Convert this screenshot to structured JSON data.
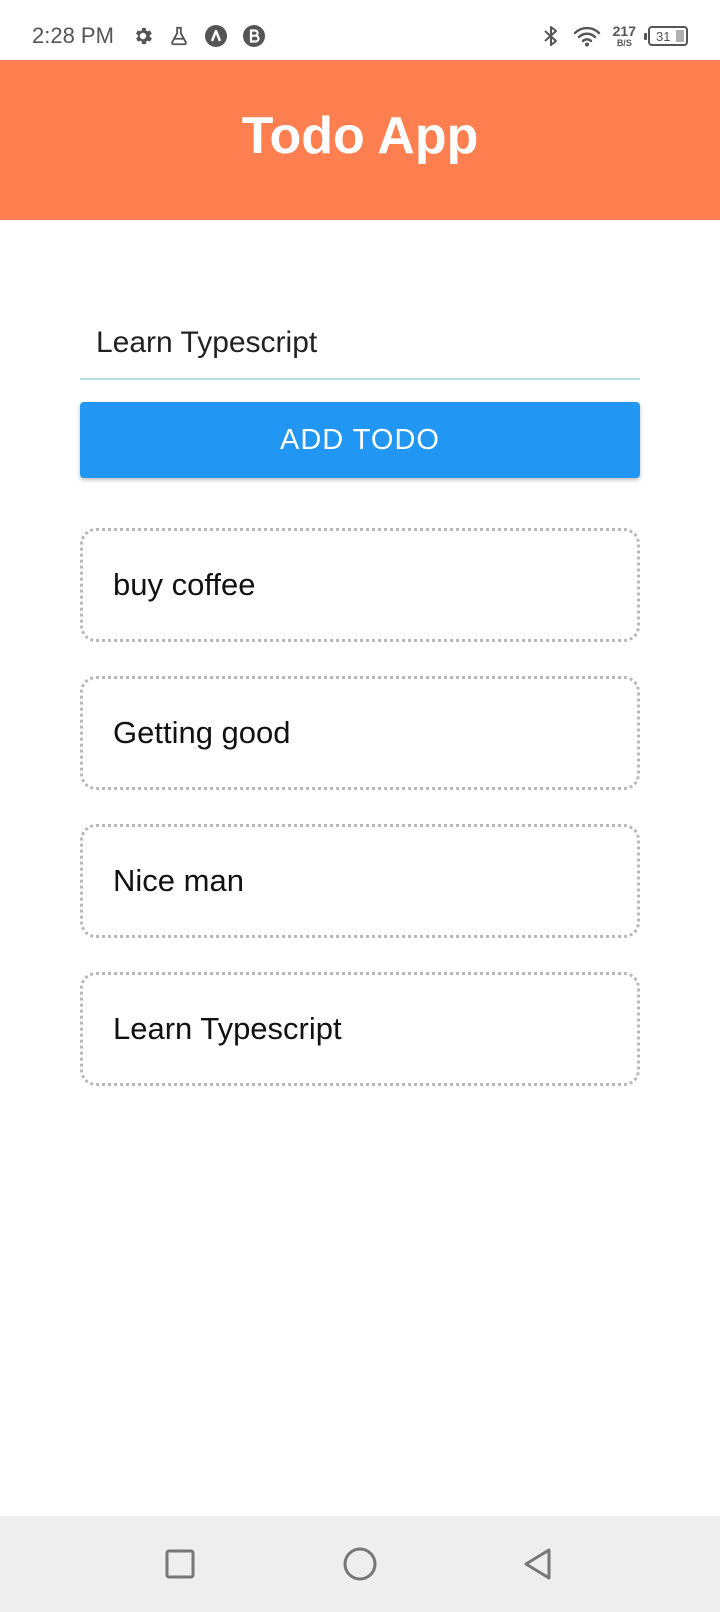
{
  "status_bar": {
    "time": "2:28 PM",
    "left_icons": [
      "gear-icon",
      "flask-icon",
      "lambda-circle-icon",
      "b-circle-icon"
    ],
    "network_speed_value": "217",
    "network_speed_unit": "B/S",
    "battery_level": "31"
  },
  "header": {
    "title": "Todo App",
    "background_color": "#ff7f50"
  },
  "input": {
    "value": "Learn Typescript",
    "underline_color": "#b2e0e0"
  },
  "add_button": {
    "label": "ADD TODO",
    "background_color": "#2196f3"
  },
  "todos": [
    {
      "text": "buy coffee"
    },
    {
      "text": "Getting good"
    },
    {
      "text": "Nice man"
    },
    {
      "text": "Learn Typescript"
    }
  ],
  "nav_bar": {
    "buttons": [
      "recent-apps-icon",
      "home-icon",
      "back-icon"
    ]
  }
}
